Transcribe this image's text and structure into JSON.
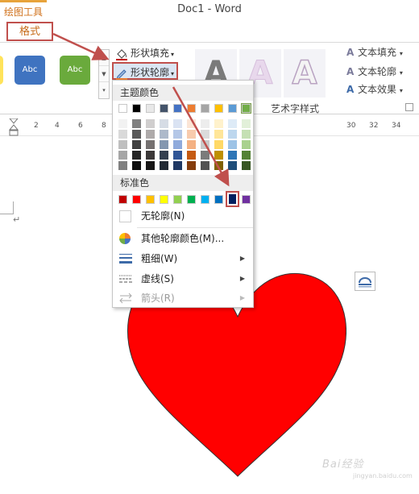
{
  "window": {
    "title": "Doc1 - Word",
    "contextual_group": "绘图工具"
  },
  "ribbon": {
    "active_tab": "格式",
    "shape_styles": [
      {
        "label": "Abc",
        "color": "#3f73c0"
      },
      {
        "label": "Abc",
        "color": "#6aaa3c"
      }
    ],
    "commands": {
      "fill": "形状填充",
      "outline": "形状轮廓"
    },
    "wordart": {
      "group_label": "艺术字样式",
      "text_fill": "文本填充",
      "text_outline": "文本轮廓",
      "text_effects": "文本效果",
      "tile_glyph": "A"
    }
  },
  "ruler": {
    "ticks": [
      "2",
      "4",
      "6",
      "8",
      "30",
      "32",
      "34"
    ]
  },
  "outline_menu": {
    "theme_colors_header": "主题颜色",
    "theme_colors": [
      "#ffffff",
      "#000000",
      "#e8e8e8",
      "#44546a",
      "#4472c4",
      "#ed7d31",
      "#a5a5a5",
      "#ffc000",
      "#5b9bd5",
      "#70ad47"
    ],
    "theme_shades": [
      [
        "#f2f2f2",
        "#d9d9d9",
        "#bfbfbf",
        "#a6a6a6",
        "#808080"
      ],
      [
        "#808080",
        "#595959",
        "#404040",
        "#262626",
        "#0d0d0d"
      ],
      [
        "#d0cece",
        "#aeaaaa",
        "#757171",
        "#3b3838",
        "#171616"
      ],
      [
        "#d6dce5",
        "#adb9ca",
        "#8497b0",
        "#333f50",
        "#222a35"
      ],
      [
        "#dae3f3",
        "#b4c7e7",
        "#8faadc",
        "#2f5597",
        "#1f3864"
      ],
      [
        "#fbe5d6",
        "#f8cbad",
        "#f4b183",
        "#c55a11",
        "#843c0c"
      ],
      [
        "#ededed",
        "#dbdbdb",
        "#c9c9c9",
        "#7b7b7b",
        "#525252"
      ],
      [
        "#fff2cc",
        "#ffe699",
        "#ffd966",
        "#bf9000",
        "#7f6000"
      ],
      [
        "#deebf7",
        "#bdd7ee",
        "#9dc3e6",
        "#2e75b6",
        "#1f4e79"
      ],
      [
        "#e2f0d9",
        "#c5e0b4",
        "#a9d18e",
        "#548235",
        "#385723"
      ]
    ],
    "standard_colors_header": "标准色",
    "standard_colors": [
      "#c00000",
      "#ff0000",
      "#ffc000",
      "#ffff00",
      "#92d050",
      "#00b050",
      "#00b0f0",
      "#0070c0",
      "#002060",
      "#7030a0"
    ],
    "selected_standard_color": "#002060",
    "no_outline": "无轮廓(N)",
    "more_colors": "其他轮廓颜色(M)...",
    "weight": "粗细(W)",
    "dashes": "虚线(S)",
    "arrows": "箭头(R)"
  },
  "document": {
    "shape": "heart",
    "shape_fill": "#ff0000"
  },
  "watermark": {
    "text": "Bai经验",
    "sub": "jingyan.baidu.com"
  },
  "annotation_color": "#c0504d"
}
